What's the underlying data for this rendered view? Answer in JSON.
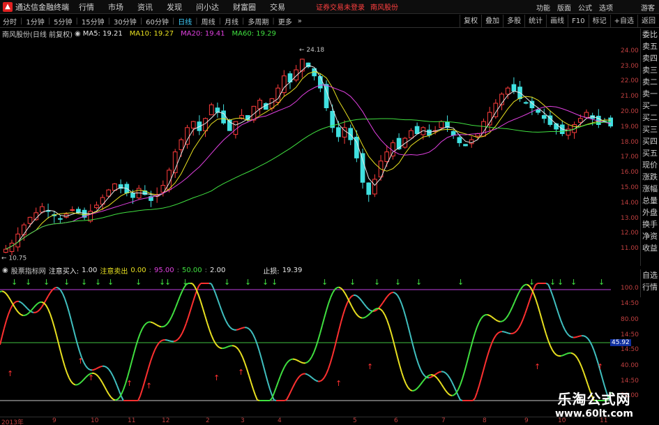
{
  "titlebar": {
    "app_title": "通达信金融终端",
    "menus": [
      "行情",
      "市场",
      "资讯",
      "发现",
      "问小达",
      "财富圈",
      "交易"
    ],
    "warning": "证券交易未登录",
    "stock_tag": "南风股份",
    "right_items": [
      "功能",
      "版面",
      "公式",
      "选项"
    ],
    "guest": "游客"
  },
  "toolbar": {
    "periods": [
      "分时",
      "1分钟",
      "5分钟",
      "15分钟",
      "30分钟",
      "60分钟",
      "日线",
      "周线",
      "月线",
      "多周期",
      "更多"
    ],
    "active": "日线",
    "more_arrow": "»",
    "right_buttons": [
      "复权",
      "叠加",
      "多股",
      "统计",
      "画线",
      "F10",
      "标记",
      "+自选",
      "返回"
    ]
  },
  "infobar": {
    "name": "南风股份(日线 前复权)",
    "ma": [
      {
        "label": "MA5: 19.21",
        "color": "#e8e8e8"
      },
      {
        "label": "MA10: 19.27",
        "color": "#e8e020"
      },
      {
        "label": "MA20: 19.41",
        "color": "#e040e0"
      },
      {
        "label": "MA60: 19.29",
        "color": "#40e040"
      }
    ]
  },
  "sidepanel": [
    "委比",
    "卖五",
    "卖四",
    "卖三",
    "卖二",
    "卖一",
    "买一",
    "买二",
    "买三",
    "买四",
    "买五",
    "现价",
    "涨跌",
    "涨幅",
    "总量",
    "外盘",
    "换手",
    "净资",
    "收益"
  ],
  "sidepanel2": [
    "自选",
    "行情"
  ],
  "price_axis": [
    "24.00",
    "23.00",
    "22.00",
    "21.00",
    "20.00",
    "19.00",
    "18.00",
    "17.00",
    "16.00",
    "15.00",
    "14.00",
    "13.00",
    "12.00",
    "11.00"
  ],
  "price_marks": {
    "high": "24.18",
    "low": "10.75"
  },
  "indicator": {
    "name": "股票指标网",
    "buy_label": "注意买入:",
    "buy_value": "1.00",
    "sell_label": "注意卖出",
    "v1": "0.00",
    "v2": "95.00",
    "v3": "50.00",
    "v4": "2.00",
    "stop_label": "止损:",
    "stop_value": "19.39",
    "axis": [
      "100.0",
      "14:50",
      "80.00",
      "14:50",
      "14:50",
      "40.00",
      "14:50",
      "20.00"
    ],
    "current": "45.92"
  },
  "dates": [
    "2013年",
    "9",
    "10",
    "11",
    "12",
    "2",
    "3",
    "4",
    "5",
    "6",
    "7",
    "8",
    "9",
    "10",
    "11"
  ],
  "watermark": {
    "line1": "乐淘公式网",
    "line2": "www.60lt.com"
  },
  "chart_data": {
    "type": "candlestick",
    "title": "南风股份(日线 前复权)",
    "high_label": 24.18,
    "low_label": 10.75,
    "ylim": [
      10.5,
      24.5
    ],
    "closes": [
      11.0,
      11.4,
      12.0,
      12.6,
      13.1,
      13.4,
      13.8,
      13.5,
      13.2,
      13.0,
      13.3,
      13.6,
      13.4,
      13.1,
      13.5,
      13.9,
      14.4,
      14.9,
      15.3,
      15.0,
      14.7,
      14.4,
      15.0,
      14.6,
      14.2,
      14.6,
      15.2,
      16.2,
      17.4,
      18.2,
      19.0,
      19.4,
      18.8,
      19.6,
      20.5,
      20.0,
      19.3,
      18.8,
      19.4,
      19.8,
      19.5,
      20.4,
      20.8,
      20.2,
      20.9,
      21.6,
      22.4,
      22.0,
      22.8,
      23.5,
      23.0,
      22.4,
      21.6,
      20.3,
      19.0,
      18.4,
      19.0,
      18.2,
      17.0,
      15.4,
      14.6,
      15.6,
      16.8,
      17.4,
      18.0,
      17.6,
      18.3,
      18.8,
      18.6,
      19.0,
      18.5,
      18.8,
      19.4,
      19.0,
      18.5,
      18.0,
      17.8,
      18.2,
      18.6,
      19.4,
      20.0,
      20.6,
      21.2,
      21.6,
      21.4,
      20.9,
      20.6,
      20.3,
      20.0,
      19.6,
      19.2,
      18.9,
      18.6,
      18.9,
      19.2,
      19.6,
      20.0,
      19.6,
      19.2,
      19.4,
      19.1
    ],
    "indicator_axis": [
      0,
      100
    ]
  }
}
